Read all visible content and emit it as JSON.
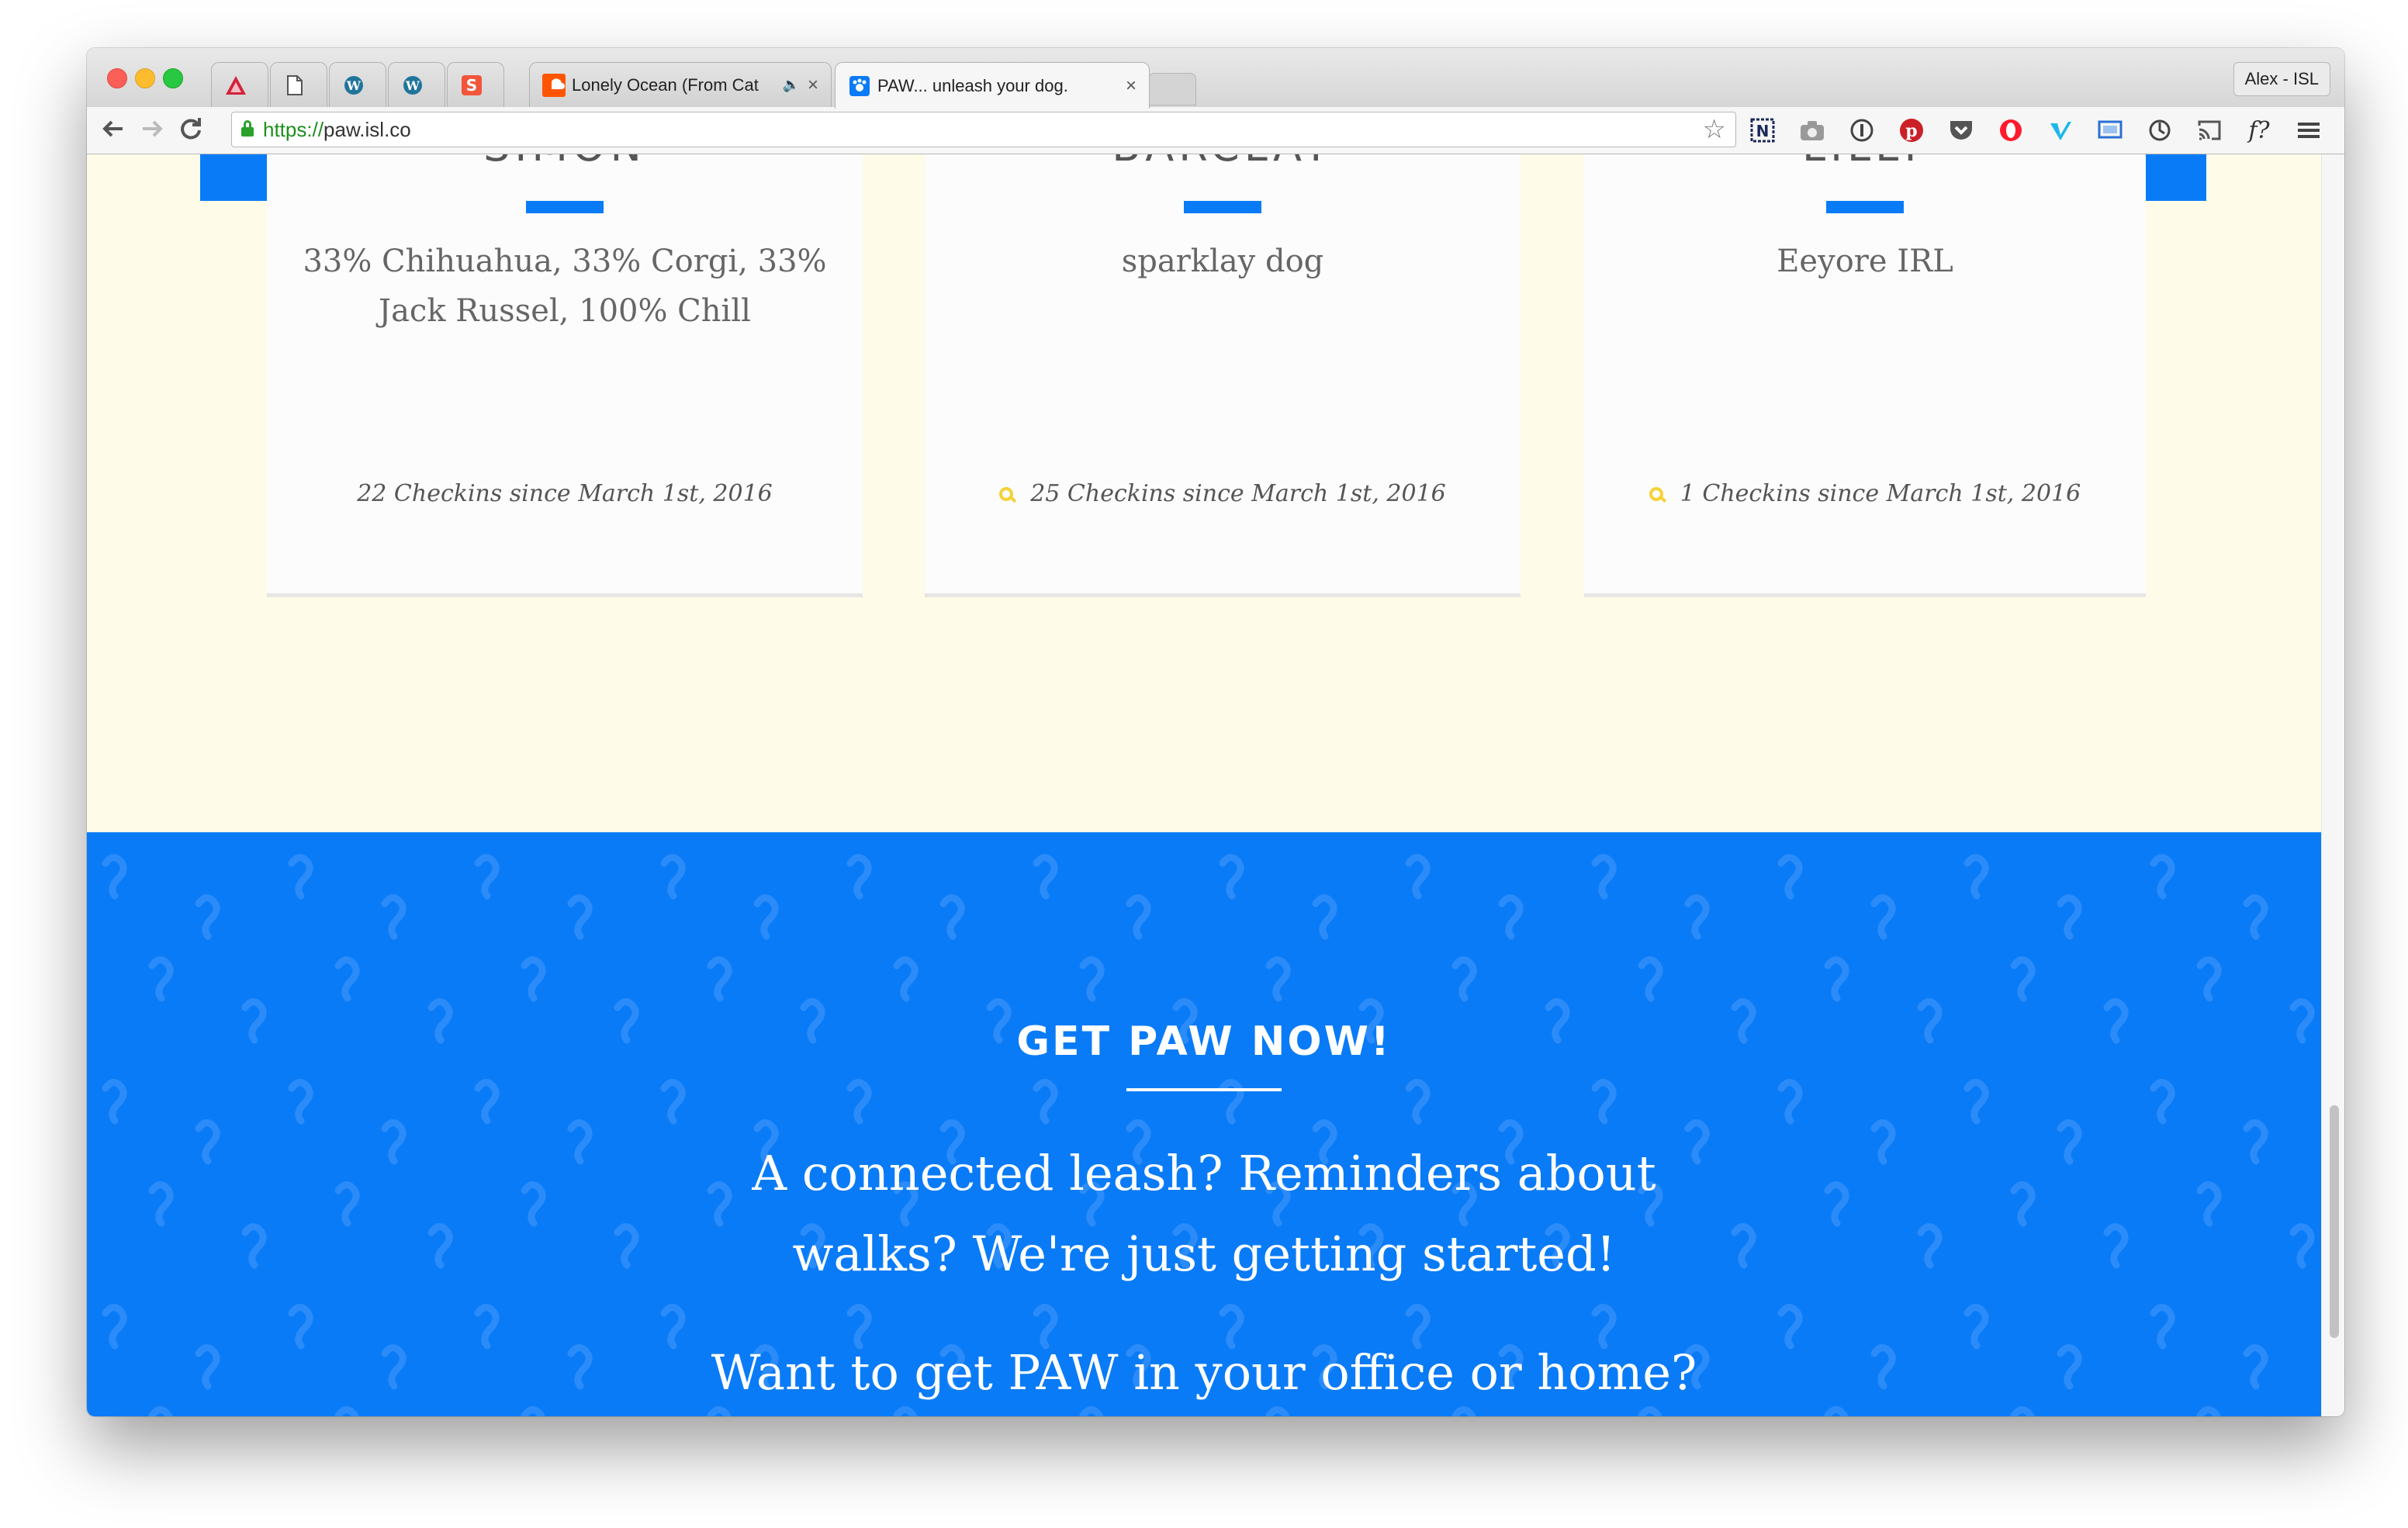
{
  "browser": {
    "profile_name": "Alex - ISL",
    "tabs": [
      {
        "label": "",
        "icon": "delta-icon"
      },
      {
        "label": "",
        "icon": "document-icon"
      },
      {
        "label": "",
        "icon": "wordpress-icon"
      },
      {
        "label": "",
        "icon": "wordpress-icon"
      },
      {
        "label": "",
        "icon": "s-app-icon"
      },
      {
        "label": "Lonely Ocean (From Cat",
        "icon": "soundcloud-icon",
        "audio": "speaker-icon",
        "close": "×"
      },
      {
        "label": "PAW... unleash your dog.",
        "icon": "paw-favicon-icon",
        "close": "×",
        "active": true
      }
    ],
    "url_scheme": "https://",
    "url_host": "paw.isl.co",
    "extensions": [
      "n-extension-icon",
      "camera-icon",
      "1password-icon",
      "pinterest-icon",
      "pocket-icon",
      "opera-icon",
      "vimeo-icon",
      "screen-icon",
      "sync-icon",
      "cast-icon",
      "f-question-icon",
      "menu-icon"
    ]
  },
  "page": {
    "cards": [
      {
        "name": "SIMON",
        "desc": "33% Chihuahua, 33% Corgi, 33% Jack Russel, 100% Chill",
        "checkins": "22 Checkins since March 1st, 2016",
        "pin": false
      },
      {
        "name": "BARCLAY",
        "desc": "sparklay dog",
        "checkins": "25 Checkins since March 1st, 2016",
        "pin": true
      },
      {
        "name": "LILLY",
        "desc": "Eeyore IRL",
        "checkins": "1 Checkins since March 1st, 2016",
        "pin": true
      }
    ],
    "cta": {
      "title": "GET PAW NOW!",
      "text": "A connected leash? Reminders about walks? We're just getting started!",
      "question": "Want to get PAW in your office or home?"
    }
  },
  "colors": {
    "accent_blue": "#0a7bf7",
    "cream_bg": "#fefbe8",
    "pin_yellow": "#f5d23a"
  }
}
